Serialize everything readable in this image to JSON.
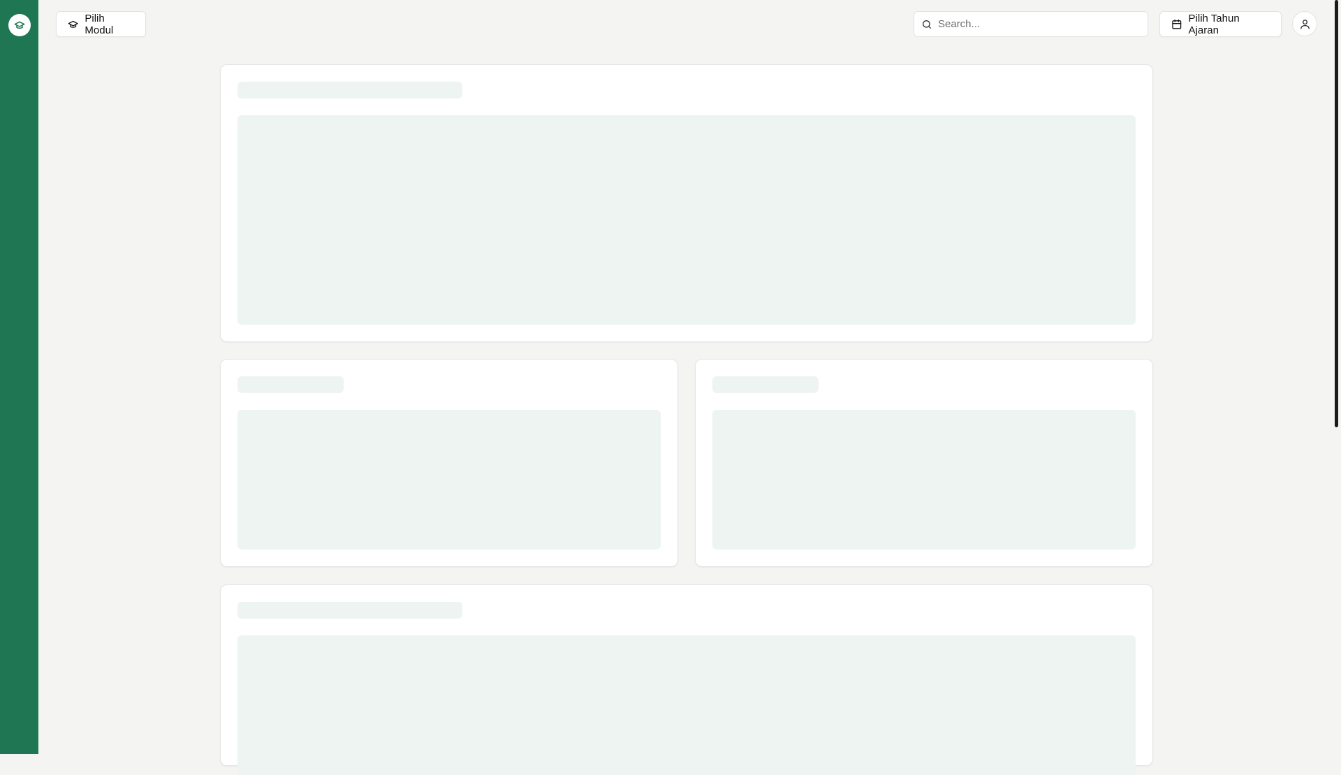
{
  "header": {
    "module_button_label": "Pilih Modul",
    "year_button_label": "Pilih Tahun Ajaran",
    "search": {
      "placeholder": "Search...",
      "value": ""
    }
  },
  "colors": {
    "sidebar": "#1e7752",
    "background": "#f4f4f2",
    "skeleton": "#eef4f1"
  },
  "icons": {
    "logo": "graduation-cap-icon",
    "module": "graduation-cap-icon",
    "search": "search-icon",
    "year": "calendar-icon",
    "user": "user-icon"
  },
  "state": "loading"
}
